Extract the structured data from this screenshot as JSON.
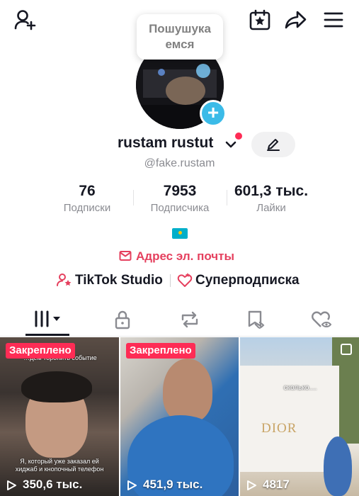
{
  "header": {
    "add_user_icon": "add-user-icon",
    "calendar_icon": "calendar-star-icon",
    "share_icon": "share-arrow-icon",
    "menu_icon": "hamburger-menu-icon"
  },
  "note_bubble": {
    "line1": "Пошушука",
    "line2": "емся"
  },
  "profile": {
    "username": "rustam rustut",
    "handle": "@fake.rustam"
  },
  "stats": [
    {
      "value": "76",
      "label": "Подписки"
    },
    {
      "value": "7953",
      "label": "Подписчика"
    },
    {
      "value": "601,3 тыс.",
      "label": "Лайки"
    }
  ],
  "email": {
    "label": "Адрес эл. почты"
  },
  "links": {
    "studio": "TikTok Studio",
    "super": "Суперподписка"
  },
  "tabs": [
    "videos",
    "private",
    "reposts",
    "favorites",
    "liked"
  ],
  "videos": [
    {
      "badge": "Закреплено",
      "views": "350,6 тыс.",
      "caption_top": "…дем торопить событие",
      "caption_bottom": "Я, который уже заказал ей хиджаб и кнопочный телефон"
    },
    {
      "badge": "Закреплено",
      "views": "451,9 тыс."
    },
    {
      "views": "4817",
      "caption": "сколько....",
      "brand": "DIOR"
    }
  ],
  "colors": {
    "accent": "#fe2c55",
    "email": "#e5405e",
    "badge_blue": "#3bbbe8",
    "muted": "#8a8b91"
  }
}
